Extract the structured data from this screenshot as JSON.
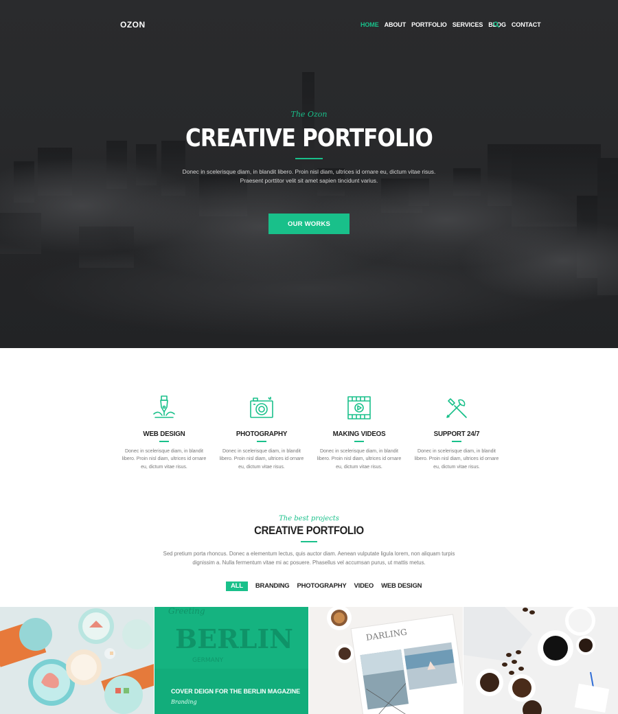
{
  "brand": {
    "logo": "OZON",
    "accent": "#19c08a"
  },
  "nav": {
    "items": [
      "HOME",
      "ABOUT",
      "PORTFOLIO",
      "SERVICES",
      "BLOG",
      "CONTACT"
    ],
    "active": "HOME",
    "search_icon": "search-icon"
  },
  "hero": {
    "kicker": "The Ozon",
    "title": "CREATIVE PORTFOLIO",
    "text_line1": "Donec in scelerisque diam, in blandit libero. Proin nisl diam, ultrices id ornare eu, dictum vitae risus.",
    "text_line2": "Praesent porttitor velit sit amet sapien tincidunt varius.",
    "button": "OUR WORKS"
  },
  "services": [
    {
      "title": "WEB DESIGN",
      "icon": "pen-tool-icon",
      "text": "Donec in scelerisque diam, in blandit libero. Proin nisl diam, ultrices id ornare eu, dictum vitae risus."
    },
    {
      "title": "PHOTOGRAPHY",
      "icon": "camera-icon",
      "text": "Donec in scelerisque diam, in blandit libero. Proin nisl diam, ultrices id ornare eu, dictum vitae risus."
    },
    {
      "title": "MAKING VIDEOS",
      "icon": "film-icon",
      "text": "Donec in scelerisque diam, in blandit libero. Proin nisl diam, ultrices id ornare eu, dictum vitae risus."
    },
    {
      "title": "SUPPORT 24/7",
      "icon": "tools-icon",
      "text": "Donec in scelerisque diam, in blandit libero. Proin nisl diam, ultrices id ornare eu, dictum vitae risus."
    }
  ],
  "portfolio": {
    "kicker": "The best projects",
    "title": "CREATIVE PORTFOLIO",
    "text_line1": "Sed pretium porta rhoncus. Donec a elementum lectus, quis auctor diam. Aenean vulputate ligula lorem, non aliquam turpis",
    "text_line2": "dignissim a. Nulla fermentum vitae mi ac posuere. Phasellus vel accumsan purus, ut mattis metus.",
    "filters": [
      "ALL",
      "BRANDING",
      "PHOTOGRAPHY",
      "VIDEO",
      "WEB DESIGN"
    ],
    "active_filter": "ALL",
    "featured": {
      "title": "COVER DEIGN FOR THE BERLIN MAGAZINE",
      "category": "Branding"
    },
    "tile_texts": {
      "berlin": "BERLIN",
      "germany": "GERMANY",
      "greeting": "Greeting",
      "notebook": "DARLING"
    }
  }
}
